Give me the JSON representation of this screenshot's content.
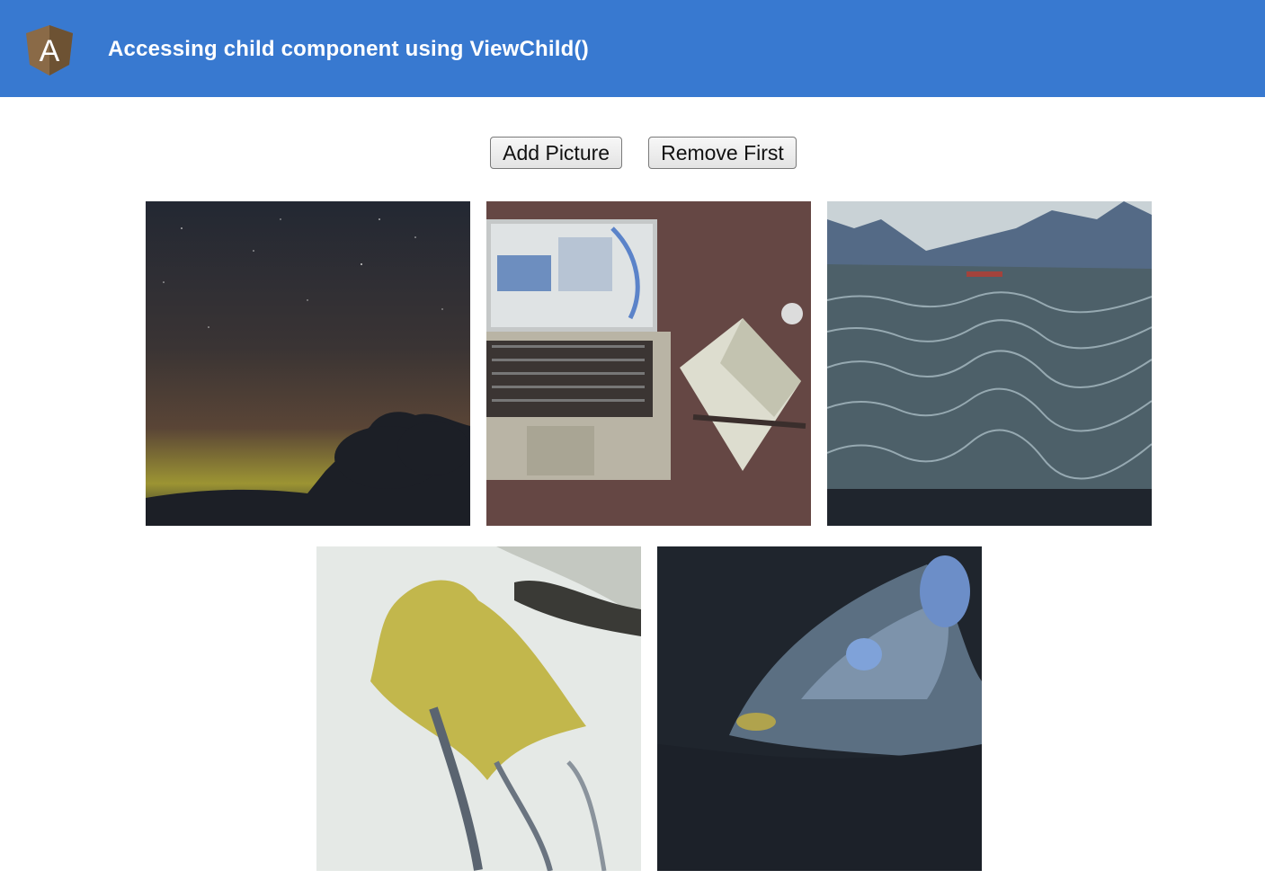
{
  "header": {
    "title": "Accessing child component using ViewChild()",
    "background": "#3879d0",
    "logo_letter": "A",
    "logo_icon": "angular-icon"
  },
  "actions": {
    "add_label": "Add Picture",
    "remove_label": "Remove First"
  },
  "gallery": {
    "pictures": [
      {
        "subject": "starry-night-sky",
        "icon": "image-icon"
      },
      {
        "subject": "laptop-and-notebook-on-desk",
        "icon": "image-icon"
      },
      {
        "subject": "sea-and-mountains",
        "icon": "image-icon"
      },
      {
        "subject": "yellow-autumn-leaf",
        "icon": "image-icon"
      },
      {
        "subject": "aurora-borealis",
        "icon": "image-icon"
      }
    ]
  }
}
